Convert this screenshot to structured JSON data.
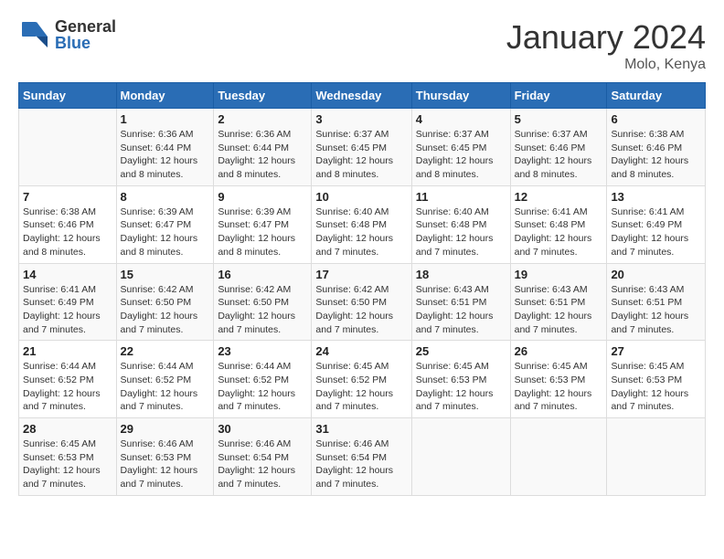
{
  "header": {
    "logo_general": "General",
    "logo_blue": "Blue",
    "month_title": "January 2024",
    "location": "Molo, Kenya"
  },
  "calendar": {
    "days_of_week": [
      "Sunday",
      "Monday",
      "Tuesday",
      "Wednesday",
      "Thursday",
      "Friday",
      "Saturday"
    ],
    "weeks": [
      [
        {
          "day": "",
          "info": ""
        },
        {
          "day": "1",
          "info": "Sunrise: 6:36 AM\nSunset: 6:44 PM\nDaylight: 12 hours\nand 8 minutes."
        },
        {
          "day": "2",
          "info": "Sunrise: 6:36 AM\nSunset: 6:44 PM\nDaylight: 12 hours\nand 8 minutes."
        },
        {
          "day": "3",
          "info": "Sunrise: 6:37 AM\nSunset: 6:45 PM\nDaylight: 12 hours\nand 8 minutes."
        },
        {
          "day": "4",
          "info": "Sunrise: 6:37 AM\nSunset: 6:45 PM\nDaylight: 12 hours\nand 8 minutes."
        },
        {
          "day": "5",
          "info": "Sunrise: 6:37 AM\nSunset: 6:46 PM\nDaylight: 12 hours\nand 8 minutes."
        },
        {
          "day": "6",
          "info": "Sunrise: 6:38 AM\nSunset: 6:46 PM\nDaylight: 12 hours\nand 8 minutes."
        }
      ],
      [
        {
          "day": "7",
          "info": "Sunrise: 6:38 AM\nSunset: 6:46 PM\nDaylight: 12 hours\nand 8 minutes."
        },
        {
          "day": "8",
          "info": "Sunrise: 6:39 AM\nSunset: 6:47 PM\nDaylight: 12 hours\nand 8 minutes."
        },
        {
          "day": "9",
          "info": "Sunrise: 6:39 AM\nSunset: 6:47 PM\nDaylight: 12 hours\nand 8 minutes."
        },
        {
          "day": "10",
          "info": "Sunrise: 6:40 AM\nSunset: 6:48 PM\nDaylight: 12 hours\nand 7 minutes."
        },
        {
          "day": "11",
          "info": "Sunrise: 6:40 AM\nSunset: 6:48 PM\nDaylight: 12 hours\nand 7 minutes."
        },
        {
          "day": "12",
          "info": "Sunrise: 6:41 AM\nSunset: 6:48 PM\nDaylight: 12 hours\nand 7 minutes."
        },
        {
          "day": "13",
          "info": "Sunrise: 6:41 AM\nSunset: 6:49 PM\nDaylight: 12 hours\nand 7 minutes."
        }
      ],
      [
        {
          "day": "14",
          "info": "Sunrise: 6:41 AM\nSunset: 6:49 PM\nDaylight: 12 hours\nand 7 minutes."
        },
        {
          "day": "15",
          "info": "Sunrise: 6:42 AM\nSunset: 6:50 PM\nDaylight: 12 hours\nand 7 minutes."
        },
        {
          "day": "16",
          "info": "Sunrise: 6:42 AM\nSunset: 6:50 PM\nDaylight: 12 hours\nand 7 minutes."
        },
        {
          "day": "17",
          "info": "Sunrise: 6:42 AM\nSunset: 6:50 PM\nDaylight: 12 hours\nand 7 minutes."
        },
        {
          "day": "18",
          "info": "Sunrise: 6:43 AM\nSunset: 6:51 PM\nDaylight: 12 hours\nand 7 minutes."
        },
        {
          "day": "19",
          "info": "Sunrise: 6:43 AM\nSunset: 6:51 PM\nDaylight: 12 hours\nand 7 minutes."
        },
        {
          "day": "20",
          "info": "Sunrise: 6:43 AM\nSunset: 6:51 PM\nDaylight: 12 hours\nand 7 minutes."
        }
      ],
      [
        {
          "day": "21",
          "info": "Sunrise: 6:44 AM\nSunset: 6:52 PM\nDaylight: 12 hours\nand 7 minutes."
        },
        {
          "day": "22",
          "info": "Sunrise: 6:44 AM\nSunset: 6:52 PM\nDaylight: 12 hours\nand 7 minutes."
        },
        {
          "day": "23",
          "info": "Sunrise: 6:44 AM\nSunset: 6:52 PM\nDaylight: 12 hours\nand 7 minutes."
        },
        {
          "day": "24",
          "info": "Sunrise: 6:45 AM\nSunset: 6:52 PM\nDaylight: 12 hours\nand 7 minutes."
        },
        {
          "day": "25",
          "info": "Sunrise: 6:45 AM\nSunset: 6:53 PM\nDaylight: 12 hours\nand 7 minutes."
        },
        {
          "day": "26",
          "info": "Sunrise: 6:45 AM\nSunset: 6:53 PM\nDaylight: 12 hours\nand 7 minutes."
        },
        {
          "day": "27",
          "info": "Sunrise: 6:45 AM\nSunset: 6:53 PM\nDaylight: 12 hours\nand 7 minutes."
        }
      ],
      [
        {
          "day": "28",
          "info": "Sunrise: 6:45 AM\nSunset: 6:53 PM\nDaylight: 12 hours\nand 7 minutes."
        },
        {
          "day": "29",
          "info": "Sunrise: 6:46 AM\nSunset: 6:53 PM\nDaylight: 12 hours\nand 7 minutes."
        },
        {
          "day": "30",
          "info": "Sunrise: 6:46 AM\nSunset: 6:54 PM\nDaylight: 12 hours\nand 7 minutes."
        },
        {
          "day": "31",
          "info": "Sunrise: 6:46 AM\nSunset: 6:54 PM\nDaylight: 12 hours\nand 7 minutes."
        },
        {
          "day": "",
          "info": ""
        },
        {
          "day": "",
          "info": ""
        },
        {
          "day": "",
          "info": ""
        }
      ]
    ]
  }
}
